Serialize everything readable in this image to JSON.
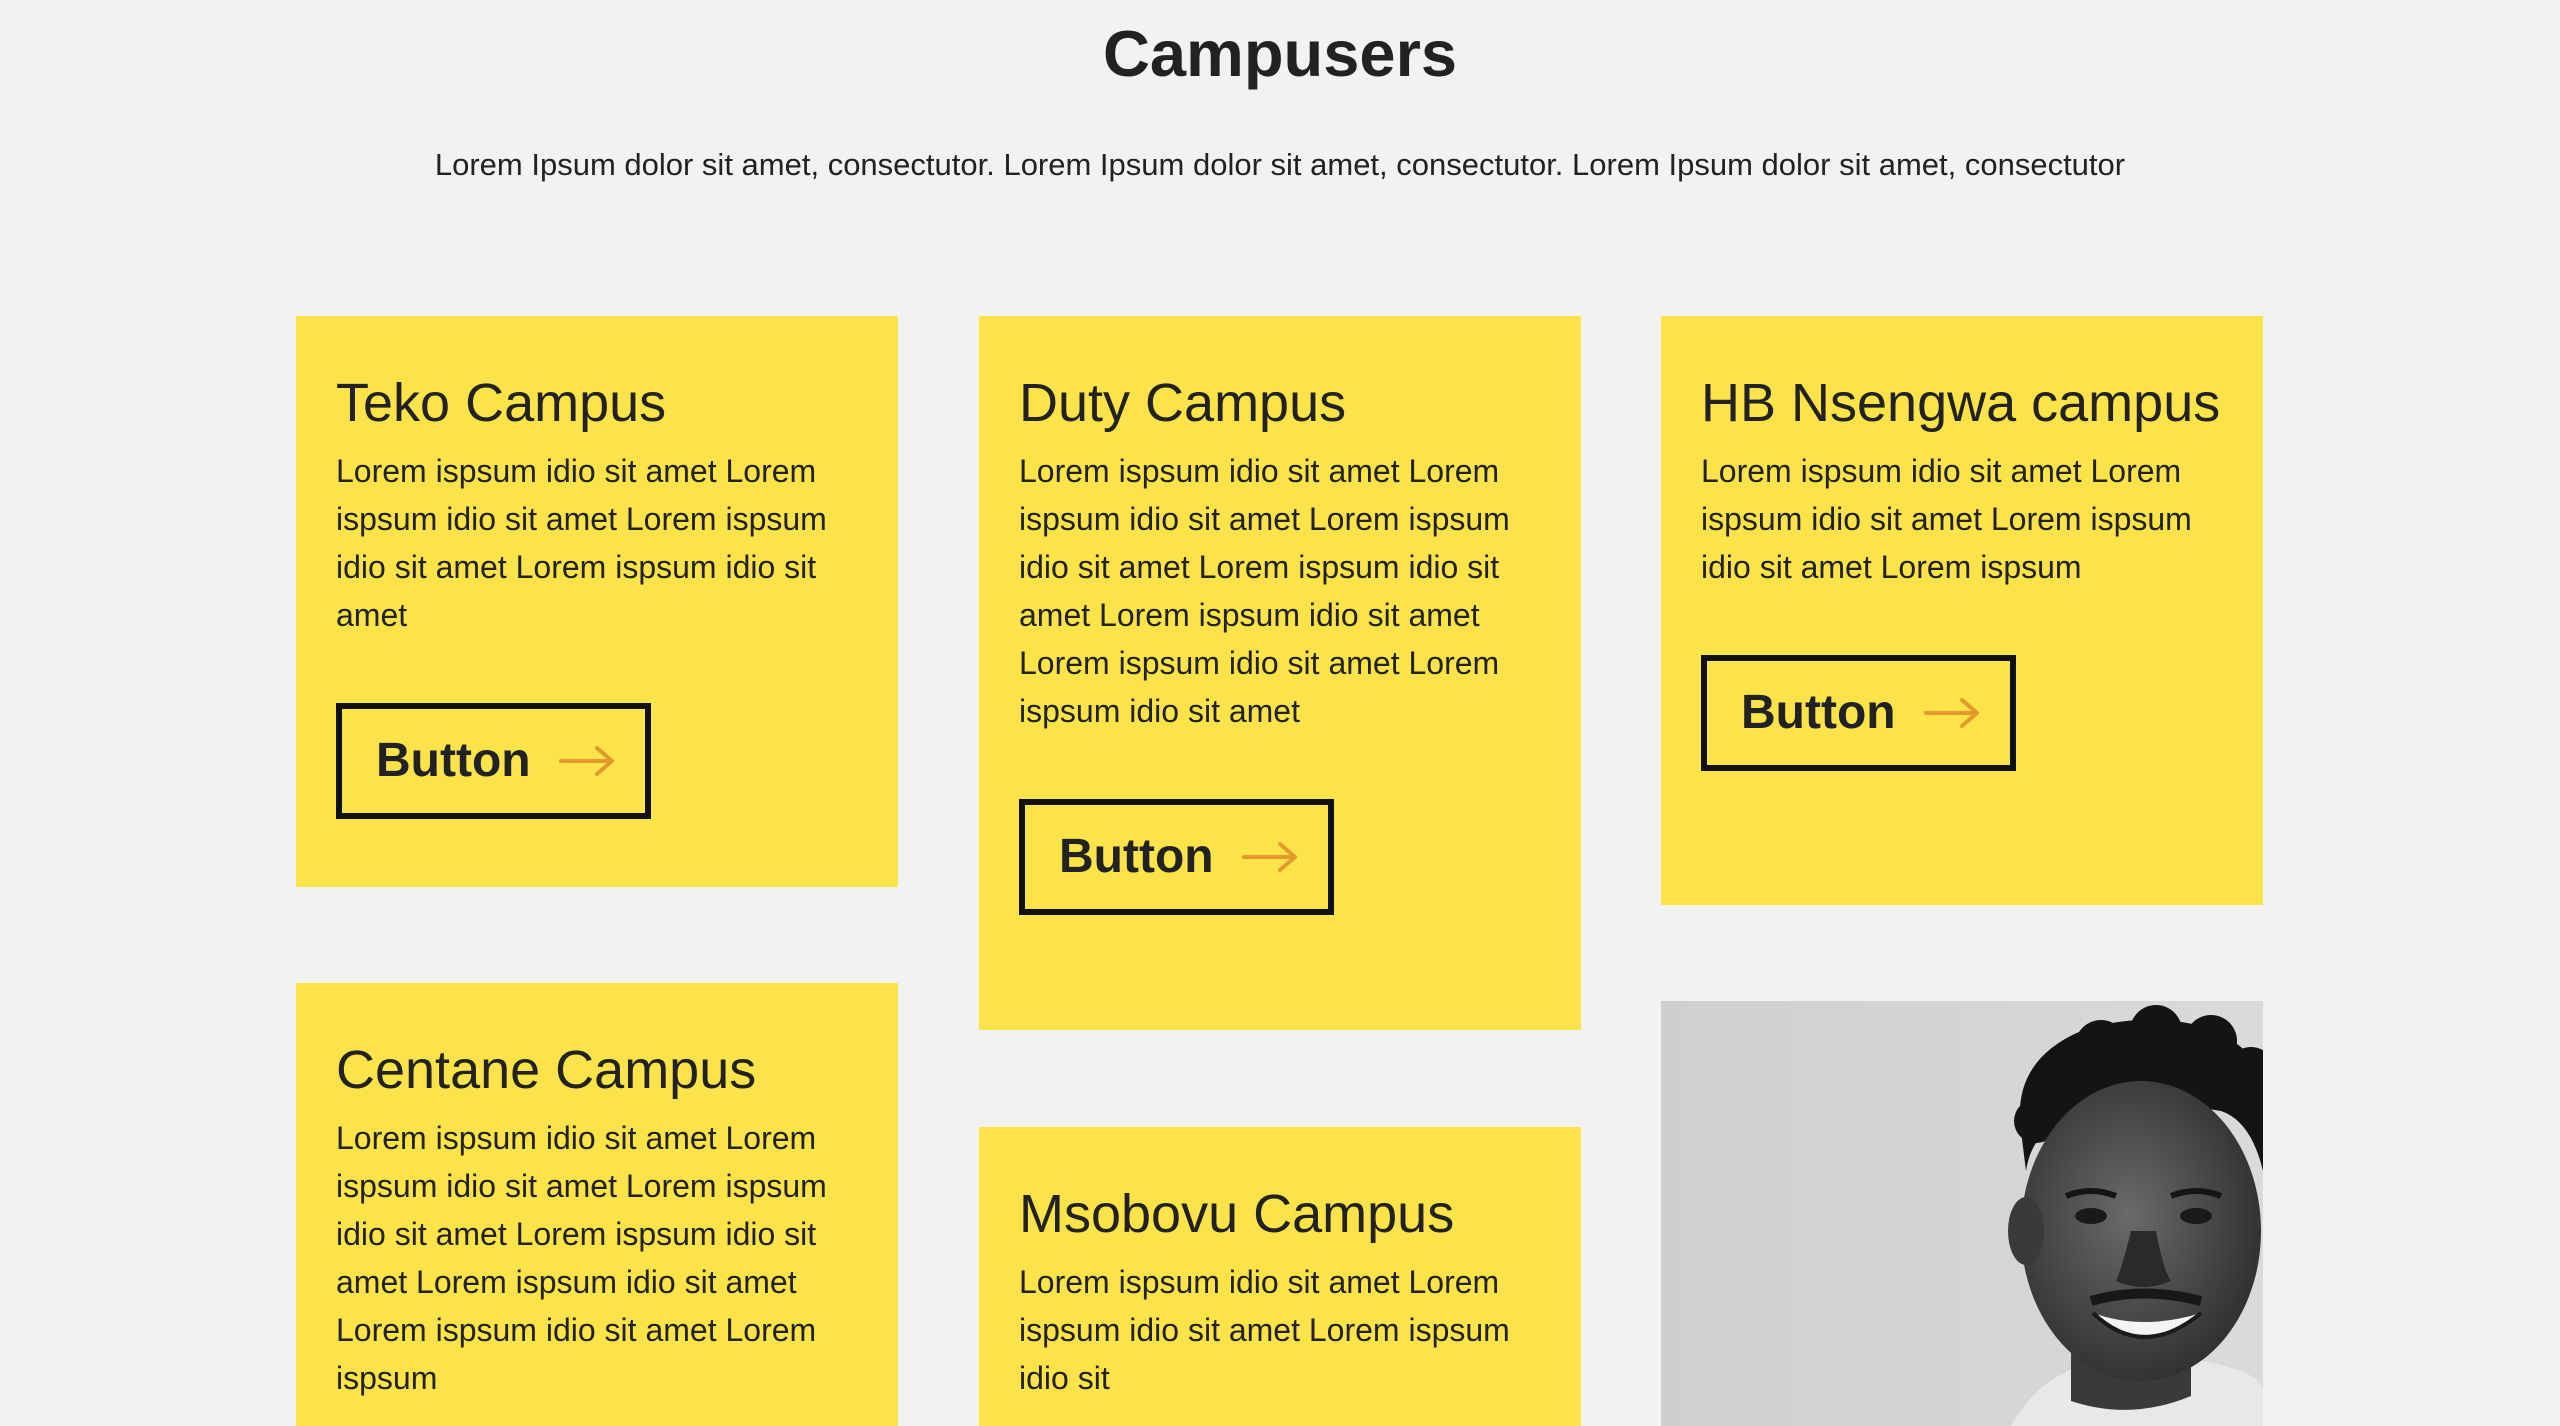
{
  "page": {
    "title": "Campusers",
    "subtitle": "Lorem Ipsum dolor sit amet, consectutor. Lorem Ipsum dolor sit amet, consectutor. Lorem Ipsum dolor sit amet, consectutor"
  },
  "colors": {
    "background": "#f2f2f2",
    "card": "#fce349",
    "text": "#222222",
    "button_border": "#111111",
    "arrow": "#e39a2b"
  },
  "icons": {
    "button_arrow": "arrow-right-icon"
  },
  "cards": [
    {
      "title": "Teko Campus",
      "text": "Lorem ispsum idio sit amet Lorem ispsum idio sit amet Lorem ispsum idio sit amet Lorem ispsum idio sit amet",
      "button_label": "Button"
    },
    {
      "title": "Duty Campus",
      "text": "Lorem ispsum idio sit amet Lorem ispsum idio sit amet Lorem ispsum idio sit amet Lorem ispsum idio sit amet Lorem ispsum idio sit amet Lorem ispsum idio sit amet Lorem ispsum idio sit amet",
      "button_label": "Button"
    },
    {
      "title": "HB Nsengwa campus",
      "text": "Lorem ispsum idio sit amet Lorem ispsum idio sit amet Lorem ispsum idio sit amet Lorem ispsum",
      "button_label": "Button"
    },
    {
      "title": "Centane Campus",
      "text": "Lorem ispsum idio sit amet Lorem ispsum idio sit amet Lorem ispsum idio sit amet Lorem ispsum idio sit amet Lorem ispsum idio sit amet Lorem ispsum idio sit amet Lorem ispsum"
    },
    {
      "title": "Msobovu Campus",
      "text": "Lorem ispsum idio sit amet Lorem ispsum idio sit amet Lorem ispsum idio sit"
    }
  ]
}
